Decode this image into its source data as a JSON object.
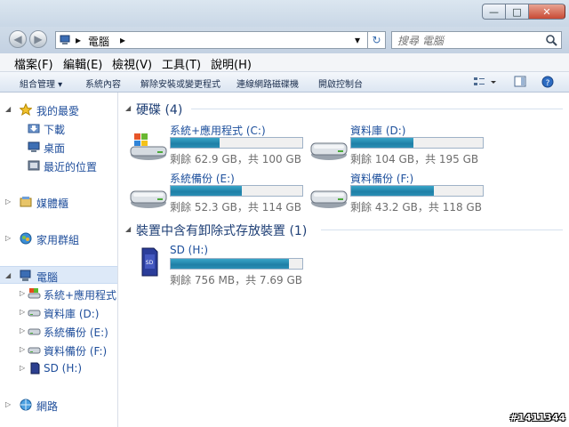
{
  "window": {
    "controls": {
      "minimize": "—",
      "maximize": "□",
      "close": "✕"
    }
  },
  "address": {
    "back": "◀",
    "forward": "▶",
    "crumb_root_sep": "▸",
    "location": "電腦",
    "crumb_sep": "▸",
    "dropdown": "▾",
    "refresh": "↻",
    "search_placeholder": "搜尋 電腦"
  },
  "menubar": [
    "檔案(F)",
    "編輯(E)",
    "檢視(V)",
    "工具(T)",
    "說明(H)"
  ],
  "toolbar": {
    "organize": "組合管理 ▾",
    "items": [
      "系統內容",
      "解除安裝或變更程式",
      "連線網路磁碟機",
      "開啟控制台"
    ]
  },
  "nav": {
    "favorites": {
      "label": "我的最愛",
      "items": [
        "下載",
        "桌面",
        "最近的位置"
      ]
    },
    "libraries": "媒體櫃",
    "homegroup": "家用群組",
    "computer": {
      "label": "電腦",
      "items": [
        "系統+應用程式 (C:)",
        "資料庫 (D:)",
        "系統備份 (E:)",
        "資料備份 (F:)",
        "SD (H:)"
      ]
    },
    "network": "網路"
  },
  "content": {
    "hard_disks": {
      "title": "硬碟 (4)",
      "drives": [
        {
          "name": "系統+應用程式 (C:)",
          "info": "剩餘 62.9 GB，共 100 GB",
          "used_fraction": 0.37
        },
        {
          "name": "資料庫 (D:)",
          "info": "剩餘 104 GB，共 195 GB",
          "used_fraction": 0.47
        },
        {
          "name": "系統備份 (E:)",
          "info": "剩餘 52.3 GB，共 114 GB",
          "used_fraction": 0.54
        },
        {
          "name": "資料備份 (F:)",
          "info": "剩餘 43.2 GB，共 118 GB",
          "used_fraction": 0.63
        }
      ]
    },
    "removable": {
      "title": "裝置中含有卸除式存放裝置 (1)",
      "drives": [
        {
          "name": "SD (H:)",
          "info": "剩餘 756 MB，共 7.69 GB",
          "used_fraction": 0.9
        }
      ]
    }
  },
  "watermark": "#1411344"
}
